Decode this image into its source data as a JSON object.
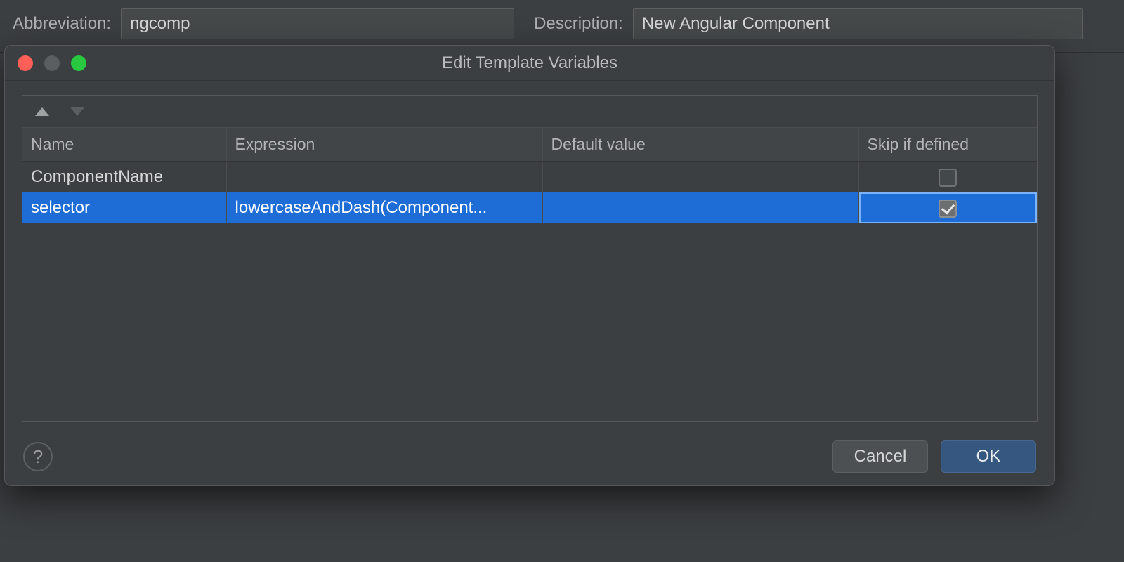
{
  "topForm": {
    "abbreviationLabel": "Abbreviation:",
    "abbreviationValue": "ngcomp",
    "descriptionLabel": "Description:",
    "descriptionValue": "New Angular Component"
  },
  "dialog": {
    "title": "Edit Template Variables",
    "columns": {
      "name": "Name",
      "expression": "Expression",
      "defaultValue": "Default value",
      "skipIfDefined": "Skip if defined"
    },
    "rows": [
      {
        "name": "ComponentName",
        "expression": "",
        "defaultValue": "",
        "skip": false,
        "selected": false
      },
      {
        "name": "selector",
        "expression": "lowercaseAndDash(Component...",
        "defaultValue": "",
        "skip": true,
        "selected": true
      }
    ],
    "buttons": {
      "cancel": "Cancel",
      "ok": "OK"
    },
    "helpGlyph": "?"
  }
}
